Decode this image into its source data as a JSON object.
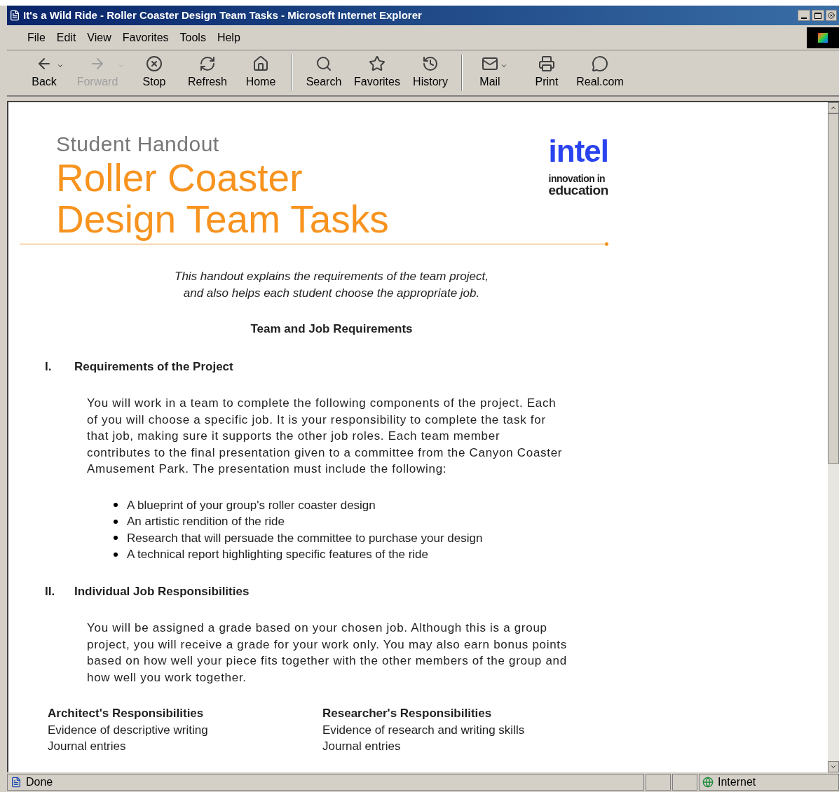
{
  "window": {
    "title": "It's a Wild Ride - Roller Coaster Design Team Tasks - Microsoft Internet Explorer"
  },
  "menu": [
    "File",
    "Edit",
    "View",
    "Favorites",
    "Tools",
    "Help"
  ],
  "toolbar": [
    {
      "buttons": [
        {
          "label": "Back",
          "disabled": false,
          "dropdown": true
        },
        {
          "label": "Forward",
          "disabled": true,
          "dropdown": true
        },
        {
          "label": "Stop",
          "disabled": false,
          "dropdown": false
        },
        {
          "label": "Refresh",
          "disabled": false,
          "dropdown": false
        },
        {
          "label": "Home",
          "disabled": false,
          "dropdown": false
        }
      ]
    },
    {
      "buttons": [
        {
          "label": "Search",
          "disabled": false,
          "dropdown": false
        },
        {
          "label": "Favorites",
          "disabled": false,
          "dropdown": false
        },
        {
          "label": "History",
          "disabled": false,
          "dropdown": false
        }
      ]
    },
    {
      "buttons": [
        {
          "label": "Mail",
          "disabled": false,
          "dropdown": true
        },
        {
          "label": "Print",
          "disabled": false,
          "dropdown": false
        },
        {
          "label": "Real.com",
          "disabled": false,
          "dropdown": false
        }
      ]
    }
  ],
  "page": {
    "kicker": "Student Handout",
    "title_lines": [
      "Roller Coaster",
      "Design Team Tasks"
    ],
    "logo": {
      "wordmark": "intel",
      "tagline": [
        "innovation in",
        "education"
      ]
    },
    "intro": [
      "This handout explains the requirements of the team project,",
      "and also helps each student choose the appropriate job."
    ],
    "heading": "Team and Job Requirements",
    "sections": [
      {
        "number": "I.",
        "title": "Requirements of the Project",
        "paragraph": "You will work in a team to complete the following components of the project. Each of you will choose a specific job. It is your responsibility to complete the task for that job, making sure it supports the other job roles. Each team member contributes to the final presentation given to a committee from the Canyon Coaster Amusement Park. The presentation must include the following:",
        "bullets": [
          "A blueprint of your group's roller coaster design",
          "An artistic rendition of the ride",
          "Research that will persuade the committee to purchase your design",
          "A technical report highlighting specific features of the ride"
        ]
      },
      {
        "number": "II.",
        "title": "Individual Job Responsibilities",
        "paragraph": "You will be assigned a grade based on your chosen job. Although this is a group project, you will receive a grade for your work only. You may also earn bonus points based on how well your piece fits together with the other members of the group and how well you work together."
      }
    ],
    "columns": [
      {
        "title": "Architect's Responsibilities",
        "items": [
          "Evidence of descriptive writing",
          "Journal entries"
        ]
      },
      {
        "title": "Researcher's Responsibilities",
        "items": [
          "Evidence of research and writing skills",
          "Journal entries"
        ]
      }
    ]
  },
  "status_bar": {
    "text": "Done",
    "zone": "Internet"
  }
}
